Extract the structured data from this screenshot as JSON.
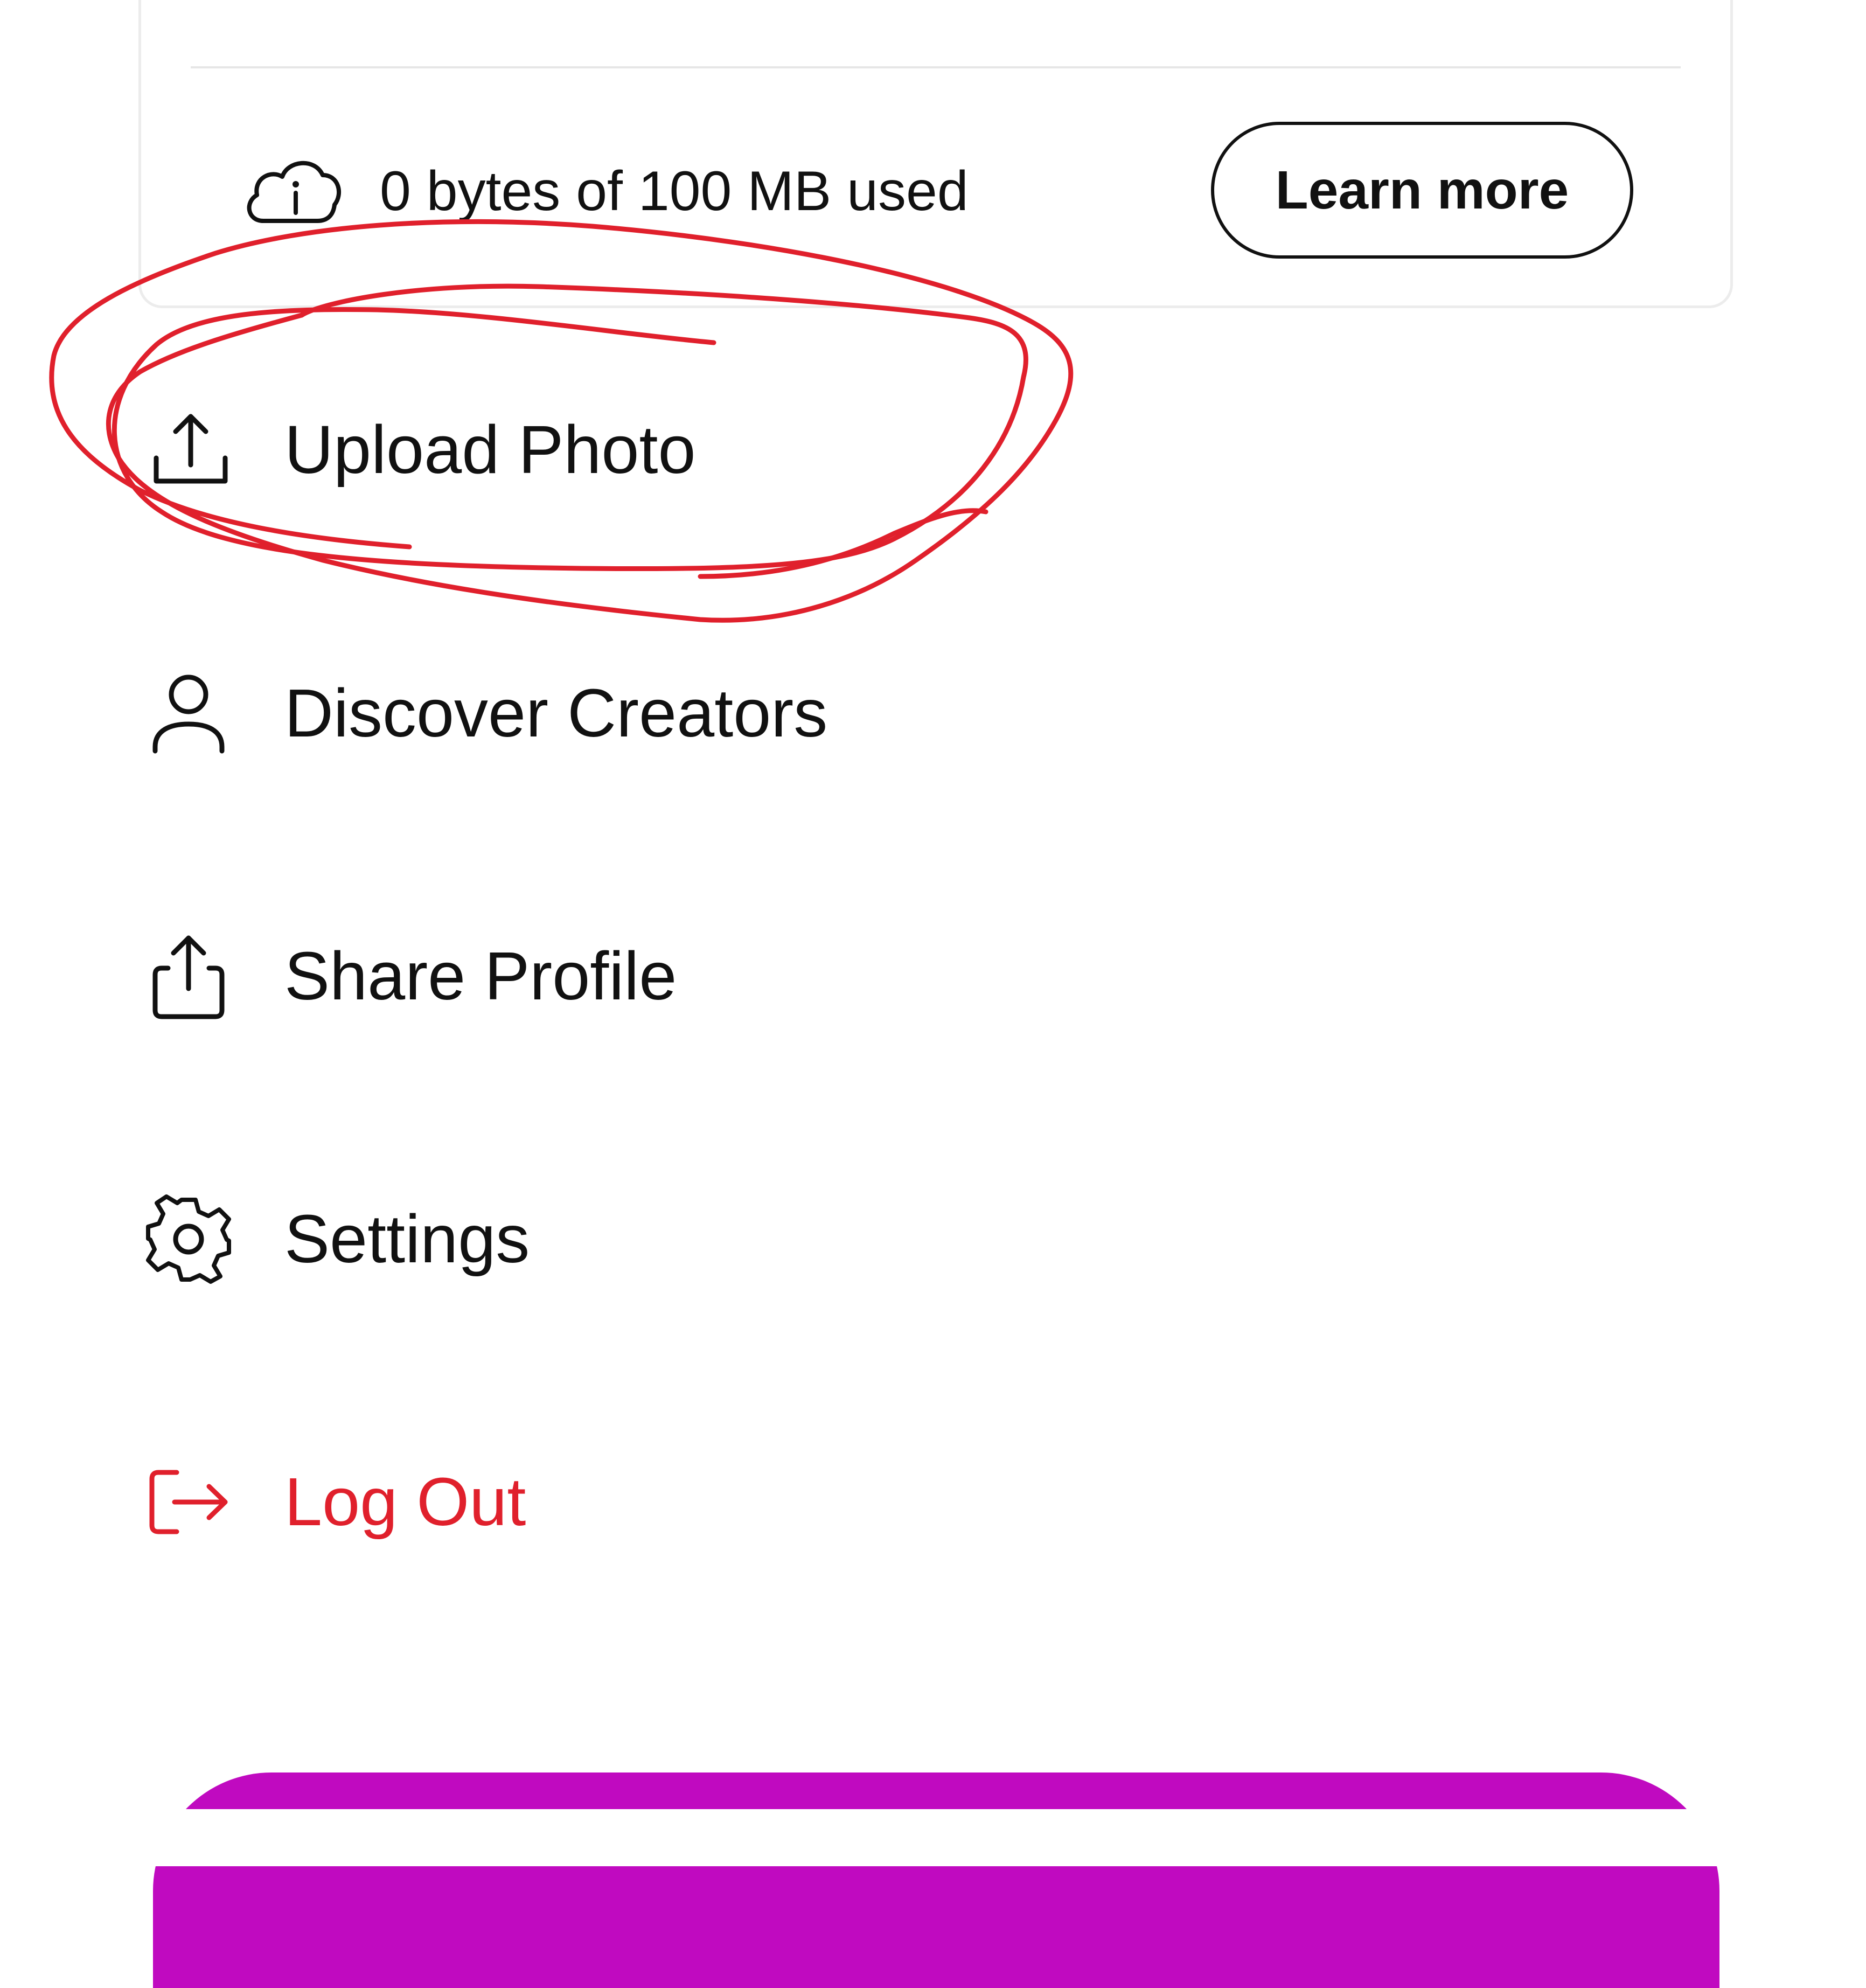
{
  "storage": {
    "usage_text": "0 bytes of 100 MB used",
    "learn_more_label": "Learn more",
    "icon": "cloud-info-icon"
  },
  "menu": {
    "items": [
      {
        "label": "Upload Photo",
        "icon": "upload-icon"
      },
      {
        "label": "Discover Creators",
        "icon": "person-icon"
      },
      {
        "label": "Share Profile",
        "icon": "share-icon"
      },
      {
        "label": "Settings",
        "icon": "gear-icon"
      },
      {
        "label": "Log Out",
        "icon": "logout-icon"
      }
    ]
  },
  "colors": {
    "accent": "#c00ac0",
    "danger": "#e0202c",
    "annotation": "#e0202c",
    "text": "#111111"
  }
}
